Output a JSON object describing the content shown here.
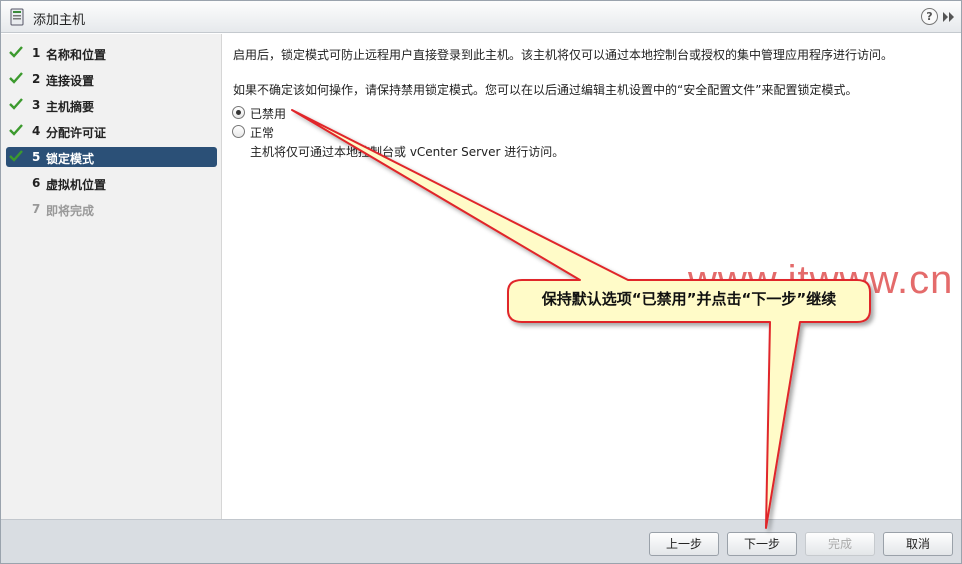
{
  "window": {
    "title": "添加主机",
    "help_label": "?"
  },
  "sidebar": {
    "items": [
      {
        "num": "1",
        "label": "名称和位置",
        "state": "done"
      },
      {
        "num": "2",
        "label": "连接设置",
        "state": "done"
      },
      {
        "num": "3",
        "label": "主机摘要",
        "state": "done"
      },
      {
        "num": "4",
        "label": "分配许可证",
        "state": "done"
      },
      {
        "num": "5",
        "label": "锁定模式",
        "state": "active"
      },
      {
        "num": "6",
        "label": "虚拟机位置",
        "state": "todo"
      },
      {
        "num": "7",
        "label": "即将完成",
        "state": "pending"
      }
    ]
  },
  "main": {
    "intro": "启用后，锁定模式可防止远程用户直接登录到此主机。该主机将仅可以通过本地控制台或授权的集中管理应用程序进行访问。",
    "hint": "如果不确定该如何操作，请保持禁用锁定模式。您可以在以后通过编辑主机设置中的“安全配置文件”来配置锁定模式。",
    "options": [
      {
        "label": "已禁用",
        "selected": true
      },
      {
        "label": "正常",
        "selected": false,
        "description": "主机将仅可通过本地控制台或 vCenter Server 进行访问。"
      }
    ]
  },
  "footer": {
    "back_label": "上一步",
    "next_label": "下一步",
    "finish_label": "完成",
    "cancel_label": "取消"
  },
  "annotation": {
    "callout_text": "保持默认选项“已禁用”并点击“下一步”继续",
    "watermark": "www.itwww.cn"
  },
  "colors": {
    "active_step_bg": "#2b5077",
    "check_green": "#3c9a2e",
    "callout_fill": "#fffbc8",
    "callout_border": "#e0262b"
  }
}
